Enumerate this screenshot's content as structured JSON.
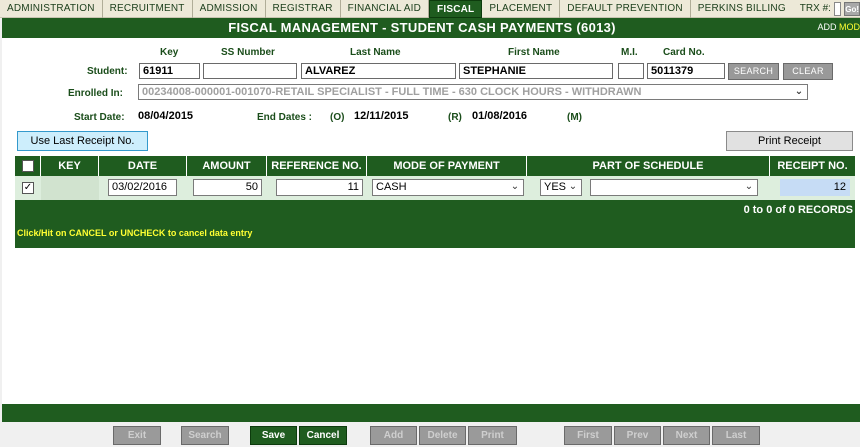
{
  "nav": {
    "items": [
      "ADMINISTRATION",
      "RECRUITMENT",
      "ADMISSION",
      "REGISTRAR",
      "FINANCIAL AID",
      "FISCAL",
      "PLACEMENT",
      "DEFAULT PREVENTION",
      "PERKINS BILLING"
    ],
    "active": "FISCAL",
    "trx_label": "TRX #:",
    "trx_value": "",
    "go_label": "Go!"
  },
  "header": {
    "title": "FISCAL MANAGEMENT - STUDENT CASH PAYMENTS (6013)",
    "mode_add": "ADD",
    "mode_mod": "MOD"
  },
  "student": {
    "row_label": "Student:",
    "col_key": "Key",
    "col_ss": "SS Number",
    "col_last": "Last Name",
    "col_first": "First Name",
    "col_mi": "M.I.",
    "col_card": "Card No.",
    "key": "61911",
    "ss": "",
    "last": "ALVAREZ",
    "first": "STEPHANIE",
    "mi": "",
    "card": "5011379",
    "search_btn": "SEARCH",
    "clear_btn": "CLEAR",
    "enrolled_label": "Enrolled In:",
    "enrolled_value": "00234008-000001-001070-RETAIL SPECIALIST - FULL TIME - 630 CLOCK HOURS - WITHDRAWN",
    "start_label": "Start Date:",
    "start_value": "08/04/2015",
    "end_label": "End Dates :",
    "end_o_tag": "(O)",
    "end_o_value": "12/11/2015",
    "end_r_tag": "(R)",
    "end_r_value": "01/08/2016",
    "end_m_tag": "(M)"
  },
  "actions": {
    "use_last_receipt": "Use Last Receipt No.",
    "print_receipt": "Print Receipt"
  },
  "grid": {
    "headers": [
      "KEY",
      "DATE",
      "AMOUNT",
      "REFERENCE NO.",
      "MODE OF PAYMENT",
      "PART OF SCHEDULE",
      "RECEIPT NO."
    ],
    "row": {
      "checked": true,
      "key": "",
      "date": "03/02/2016",
      "amount": "50",
      "reference": "11",
      "mode": "CASH",
      "part_yes": "YES",
      "schedule": "",
      "receipt": "12"
    },
    "records": "0 to 0 of 0 RECORDS",
    "hint": "Click/Hit on CANCEL or UNCHECK to cancel data entry"
  },
  "toolbar": {
    "exit": "Exit",
    "search": "Search",
    "save": "Save",
    "cancel": "Cancel",
    "add": "Add",
    "delete": "Delete",
    "print": "Print",
    "first": "First",
    "prev": "Prev",
    "next": "Next",
    "last": "Last"
  },
  "colors": {
    "brand_green": "#1f5c1f",
    "highlight_yellow": "#ffff33",
    "receipt_field": "#c6dcf5",
    "use_last_bg": "#cdeefc"
  }
}
